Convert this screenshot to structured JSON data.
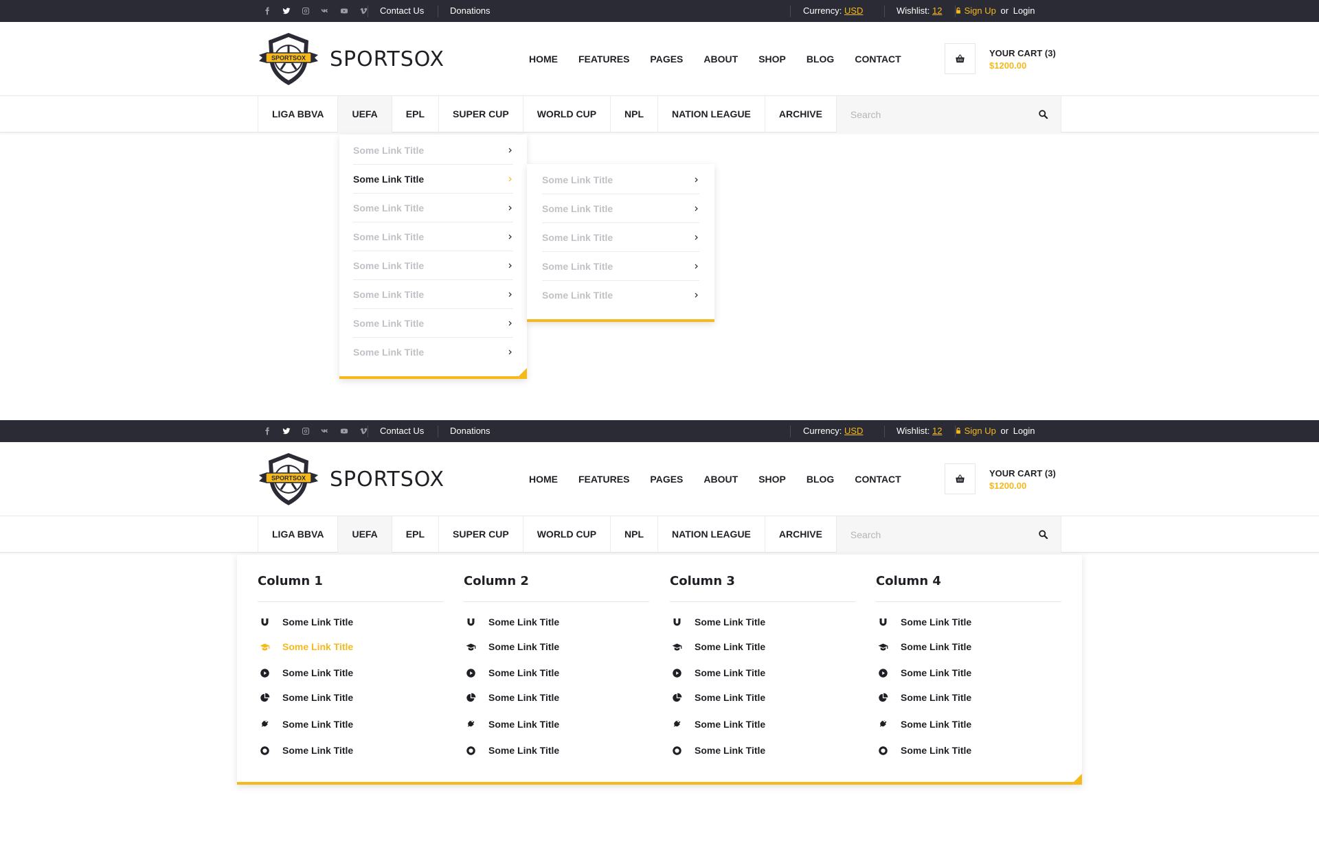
{
  "colors": {
    "accent": "#f5b91b",
    "dark": "#2a2b34"
  },
  "topbar": {
    "social_icons": [
      "facebook-icon",
      "twitter-icon",
      "instagram-icon",
      "vk-icon",
      "youtube-icon",
      "vimeo-icon"
    ],
    "contact_us": "Contact Us",
    "donations": "Donations",
    "currency_label": "Currency:",
    "currency_value": "USD",
    "wishlist_label": "Wishlist:",
    "wishlist_count": "12",
    "sign_up": "Sign Up",
    "or": "or",
    "login": "Login"
  },
  "header": {
    "brand": "SPORTSOX",
    "logo_text": "SPORTSOX",
    "nav": [
      "HOME",
      "FEATURES",
      "PAGES",
      "ABOUT",
      "SHOP",
      "BLOG",
      "CONTACT"
    ],
    "cart_title": "YOUR CART (3)",
    "cart_price": "$1200.00"
  },
  "categories": [
    "LIGA BBVA",
    "UEFA",
    "EPL",
    "SUPER CUP",
    "WORLD CUP",
    "NPL",
    "NATION LEAGUE",
    "ARCHIVE"
  ],
  "search": {
    "placeholder": "Search"
  },
  "dropdown": {
    "items": [
      "Some Link Title",
      "Some Link Title",
      "Some Link Title",
      "Some Link Title",
      "Some Link Title",
      "Some Link Title",
      "Some Link Title",
      "Some Link Title"
    ],
    "active_index": 1
  },
  "submenu": {
    "items": [
      "Some Link Title",
      "Some Link Title",
      "Some Link Title",
      "Some Link Title",
      "Some Link Title"
    ]
  },
  "megamenu": {
    "columns": [
      {
        "title": "Column 1",
        "items": [
          "Some Link Title",
          "Some Link Title",
          "Some Link Title",
          "Some Link Title",
          "Some Link Title",
          "Some Link Title"
        ]
      },
      {
        "title": "Column 2",
        "items": [
          "Some Link Title",
          "Some Link Title",
          "Some Link Title",
          "Some Link Title",
          "Some Link Title",
          "Some Link Title"
        ]
      },
      {
        "title": "Column 3",
        "items": [
          "Some Link Title",
          "Some Link Title",
          "Some Link Title",
          "Some Link Title",
          "Some Link Title",
          "Some Link Title"
        ]
      },
      {
        "title": "Column 4",
        "items": [
          "Some Link Title",
          "Some Link Title",
          "Some Link Title",
          "Some Link Title",
          "Some Link Title",
          "Some Link Title"
        ]
      }
    ],
    "item_icons": [
      "magnet-icon",
      "graduation-cap-icon",
      "play-circle-icon",
      "pie-chart-icon",
      "plug-icon",
      "life-ring-icon"
    ],
    "active_column": 0,
    "active_item": 1
  }
}
